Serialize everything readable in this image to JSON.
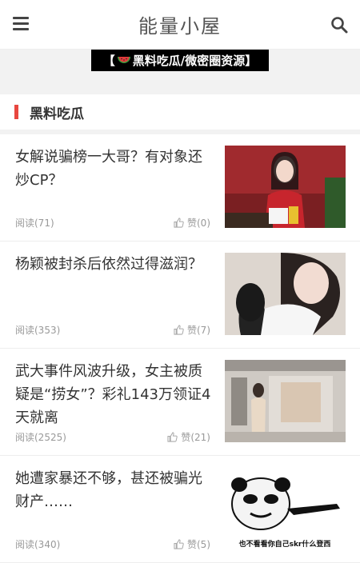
{
  "header": {
    "title": "能量小屋"
  },
  "banner": {
    "text_left": "【",
    "text_right": "黑料吃瓜/微密圈资源】"
  },
  "section": {
    "title": "黑料吃瓜"
  },
  "articles": [
    {
      "title": "女解说骗榜一大哥？有对象还炒CP？",
      "reads": "阅读(71)",
      "likes": "赞(0)"
    },
    {
      "title": "杨颖被封杀后依然过得滋润？",
      "reads": "阅读(353)",
      "likes": "赞(7)"
    },
    {
      "title": "武大事件风波升级，女主被质疑是“捞女”？彩礼143万领证4天就离",
      "reads": "阅读(2525)",
      "likes": "赞(21)"
    },
    {
      "title": "她遭家暴还不够，甚还被骗光财产……",
      "reads": "阅读(340)",
      "likes": "赞(5)",
      "image_caption": "也不看看你自己skr什么登西"
    }
  ]
}
